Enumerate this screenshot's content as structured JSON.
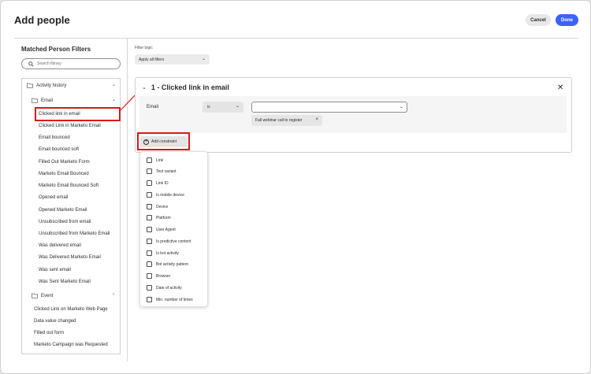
{
  "dialog": {
    "title": "Add people",
    "cancel_label": "Cancel",
    "done_label": "Done"
  },
  "left_panel": {
    "title": "Matched Person Filters",
    "search_placeholder": "Search library",
    "tree": {
      "activity_history": "Activity history",
      "email_folder": "Email",
      "email_items": [
        "Clicked link in email",
        "Clicked Link in Marketo Email",
        "Email bounced",
        "Email bounced soft",
        "Filled Out Marketo Form",
        "Marketo Email Bounced",
        "Marketo Email Bounced Soft",
        "Opened email",
        "Opened Marketo Email",
        "Unsubscribed from email",
        "Unsubscribed from Marketo Email",
        "Was delivered email",
        "Was Delivered Marketo Email",
        "Was sent email",
        "Was Sent Marketo Email"
      ],
      "event_folder": "Event",
      "root_items": [
        "Clicked Link on Marketo Web Page",
        "Data value changed",
        "Filled out form",
        "Marketo Campaign was Requested"
      ]
    }
  },
  "filter_logic": {
    "label": "Filter logic",
    "value": "Apply all filters"
  },
  "filter_card": {
    "title": "1 - Clicked link in email",
    "field_label": "Email",
    "operator": "is",
    "value": "",
    "tag": "Fall webinar call to register",
    "add_constraint_label": "Add constraint"
  },
  "constraint_options": [
    "Link",
    "Test variant",
    "Link ID",
    "Is mobile device",
    "Device",
    "Platform",
    "User Agent",
    "Is predictive content",
    "Is bot activity",
    "Bot activity pattern",
    "Browser",
    "Date of activity",
    "Min. number of times"
  ],
  "colors": {
    "accent": "#3b63fb",
    "highlight": "#d7191c"
  }
}
